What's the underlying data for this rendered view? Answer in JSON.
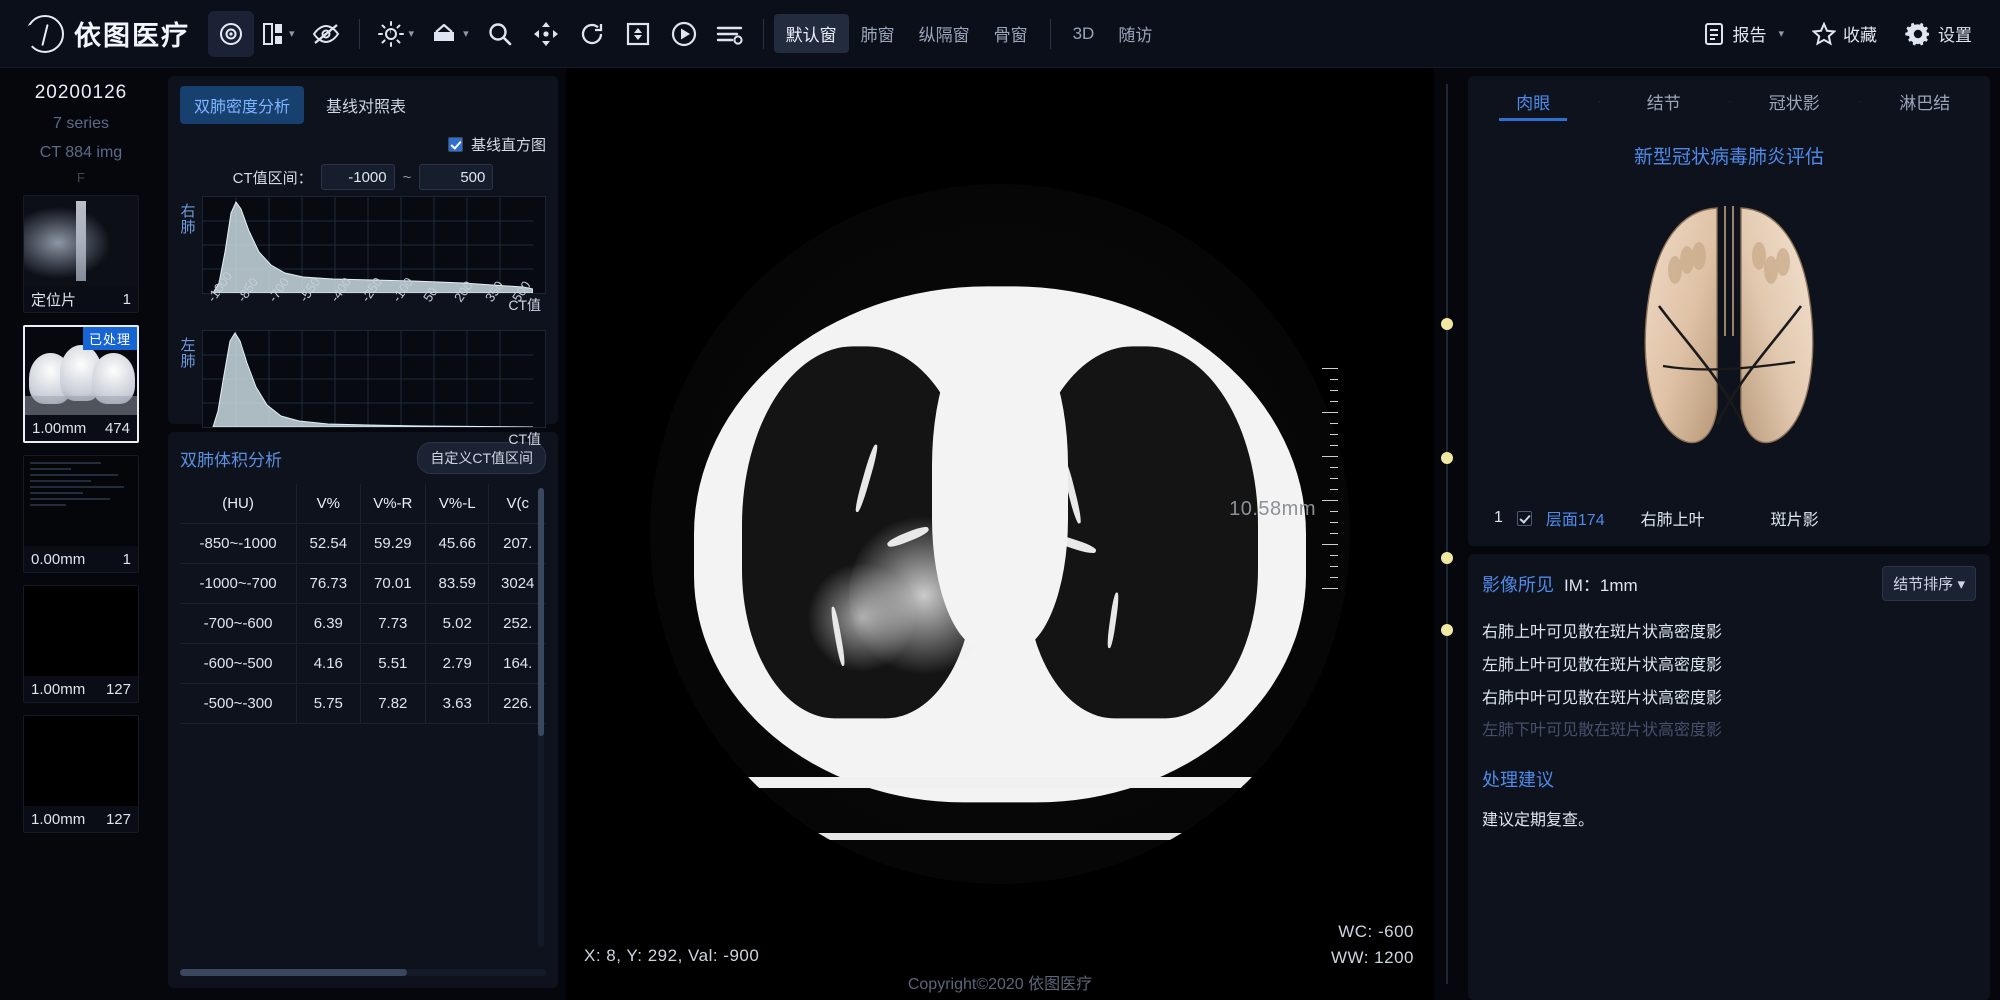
{
  "app": {
    "brand": "依图医疗",
    "copyright": "Copyright©2020 依图医疗"
  },
  "toolbar": {
    "icons": [
      {
        "name": "target-icon",
        "label": "定位"
      },
      {
        "name": "layout-icon",
        "label": "布局"
      },
      {
        "name": "eye-off-icon",
        "label": "隐藏标注"
      },
      {
        "name": "brightness-icon",
        "label": "窗宽窗位"
      },
      {
        "name": "export-icon",
        "label": "导出"
      },
      {
        "name": "magnifier-icon",
        "label": "放大"
      },
      {
        "name": "move-icon",
        "label": "移动"
      },
      {
        "name": "reset-icon",
        "label": "重置"
      },
      {
        "name": "save-icon",
        "label": "保存"
      },
      {
        "name": "play-icon",
        "label": "播放"
      },
      {
        "name": "measure-icon",
        "label": "测量"
      }
    ],
    "window_presets": [
      {
        "label": "默认窗",
        "active": true
      },
      {
        "label": "肺窗",
        "active": false
      },
      {
        "label": "纵隔窗",
        "active": false
      },
      {
        "label": "骨窗",
        "active": false
      }
    ],
    "mode_buttons": [
      {
        "label": "3D"
      },
      {
        "label": "随访"
      }
    ],
    "right_items": [
      {
        "icon": "document-icon",
        "label": "报告",
        "caret": "▾"
      },
      {
        "icon": "star-icon",
        "label": "收藏",
        "caret": ""
      },
      {
        "icon": "gear-icon",
        "label": "设置",
        "caret": ""
      }
    ]
  },
  "series_rail": {
    "study_date": "20200126",
    "series_count": "7 series",
    "modality_images": "CT 884 img",
    "extra": "F",
    "items": [
      {
        "name": "定位片",
        "count": "1",
        "kind": "scout",
        "selected": false,
        "badge": ""
      },
      {
        "name": "1.00mm",
        "count": "474",
        "kind": "axial",
        "selected": true,
        "badge": "已处理"
      },
      {
        "name": "0.00mm",
        "count": "1",
        "kind": "dose",
        "selected": false,
        "badge": ""
      },
      {
        "name": "1.00mm",
        "count": "127",
        "kind": "blank",
        "selected": false,
        "badge": ""
      },
      {
        "name": "1.00mm",
        "count": "127",
        "kind": "blank",
        "selected": false,
        "badge": ""
      }
    ]
  },
  "density_panel": {
    "tabs": [
      {
        "label": "双肺密度分析",
        "active": true
      },
      {
        "label": "基线对照表",
        "active": false
      }
    ],
    "baseline_checkbox": {
      "label": "基线直方图",
      "checked": true
    },
    "ct_range": {
      "label": "CT值区间：",
      "min": "-1000",
      "max": "500",
      "separator": "~"
    },
    "axis_name": "CT值",
    "right_lung_label": "右肺",
    "left_lung_label": "左肺",
    "x_ticks": [
      "-1000",
      "-850",
      "-700",
      "-550",
      "-400",
      "-250",
      "-100",
      "50",
      "200",
      "350",
      "500"
    ]
  },
  "chart_data": [
    {
      "type": "area",
      "title": "右肺 CT值直方图",
      "xlabel": "CT值",
      "ylabel": "",
      "xlim": [
        -1000,
        500
      ],
      "categories": [
        "-1000",
        "-850",
        "-700",
        "-550",
        "-400",
        "-250",
        "-100",
        "50",
        "200",
        "350",
        "500"
      ],
      "series": [
        {
          "name": "右肺",
          "values": [
            3,
            96,
            52,
            23,
            15,
            12,
            11,
            10,
            9,
            7,
            4
          ]
        }
      ],
      "grid": true,
      "legend": "none"
    },
    {
      "type": "area",
      "title": "左肺 CT值直方图",
      "xlabel": "CT值",
      "ylabel": "",
      "xlim": [
        -1000,
        500
      ],
      "categories": [
        "-1000",
        "-850",
        "-700",
        "-550",
        "-400",
        "-250",
        "-100",
        "50",
        "200",
        "350",
        "500"
      ],
      "series": [
        {
          "name": "左肺",
          "values": [
            4,
            100,
            38,
            12,
            6,
            4,
            3,
            2,
            2,
            1,
            1
          ]
        }
      ],
      "grid": true,
      "legend": "none"
    }
  ],
  "volume_panel": {
    "title": "双肺体积分析",
    "custom_button": "自定义CT值区间",
    "columns": [
      "(HU)",
      "V%",
      "V%-R",
      "V%-L",
      "V(c"
    ],
    "rows": [
      [
        "-850~-1000",
        "52.54",
        "59.29",
        "45.66",
        "207."
      ],
      [
        "-1000~-700",
        "76.73",
        "70.01",
        "83.59",
        "3024"
      ],
      [
        "-700~-600",
        "6.39",
        "7.73",
        "5.02",
        "252."
      ],
      [
        "-600~-500",
        "4.16",
        "5.51",
        "2.79",
        "164."
      ],
      [
        "-500~-300",
        "5.75",
        "7.82",
        "3.63",
        "226."
      ]
    ]
  },
  "viewer": {
    "coords": "X: 8, Y: 292, Val: -900",
    "wc": "WC: -600",
    "ww": "WW: 1200",
    "scale_label": "10.58mm"
  },
  "right_panel": {
    "tabs": [
      {
        "label": "肉眼",
        "active": true
      },
      {
        "label": "结节",
        "active": false
      },
      {
        "label": "冠状影",
        "active": false
      },
      {
        "label": "淋巴结",
        "active": false
      }
    ],
    "assessment_title": "新型冠状病毒肺炎评估",
    "nodule_row": {
      "seq": "1",
      "checked": true,
      "slice_label": "层面174",
      "location": "右肺上叶",
      "type": "斑片影"
    },
    "findings": {
      "title": "影像所见",
      "im_label": "IM：1mm",
      "sort_button": "结节排序 ▾",
      "lines": [
        {
          "text": "右肺上叶可见散在斑片状高密度影",
          "faded": false
        },
        {
          "text": "左肺上叶可见散在斑片状高密度影",
          "faded": false
        },
        {
          "text": "右肺中叶可见散在斑片状高密度影",
          "faded": false
        },
        {
          "text": "左肺下叶可见散在斑片状高密度影",
          "faded": true
        }
      ]
    },
    "advice": {
      "title": "处理建议",
      "text": "建议定期复查。"
    }
  }
}
